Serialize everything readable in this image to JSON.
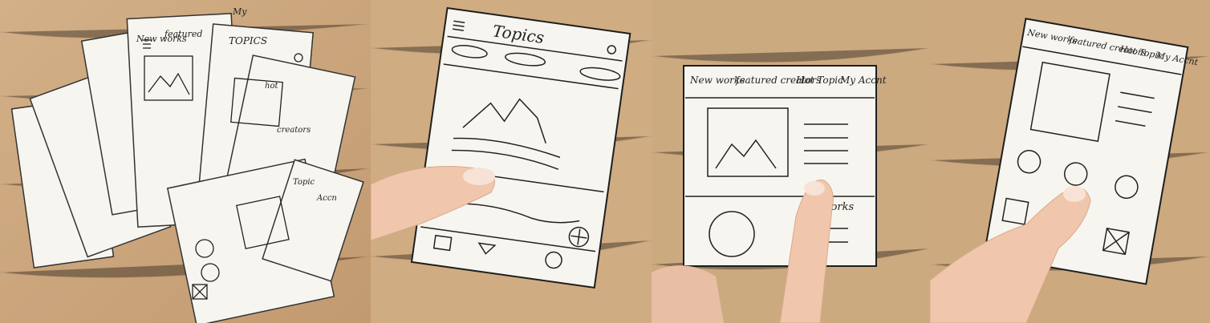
{
  "photos": [
    {
      "id": "scattered-prototypes",
      "sketch_words": {
        "new_works": "New works",
        "featured": "featured",
        "topics": "TOPICS",
        "my": "My",
        "crafters": "creators",
        "hot": "hot",
        "topic": "Topic",
        "accounts": "Accn"
      }
    },
    {
      "id": "topics-screen",
      "screen": {
        "title": "Topics",
        "icons": [
          "menu-icon",
          "search-icon",
          "image-placeholder-icon",
          "add-icon",
          "home-icon",
          "user-icon"
        ]
      }
    },
    {
      "id": "work-detail-screen",
      "screen": {
        "nav": [
          "New works",
          "featured creators",
          "Hot Topic",
          "My Accnt"
        ],
        "related_label": "d works"
      }
    },
    {
      "id": "creators-screen",
      "screen": {
        "nav": [
          "New works",
          "featured creators",
          "Hot Topic",
          "My Accnt"
        ]
      }
    }
  ],
  "colors": {
    "wood": "#c9a57c",
    "paper": "#f7f5f0",
    "ink": "#1e1e1e",
    "skin": "#f0c7ad"
  }
}
